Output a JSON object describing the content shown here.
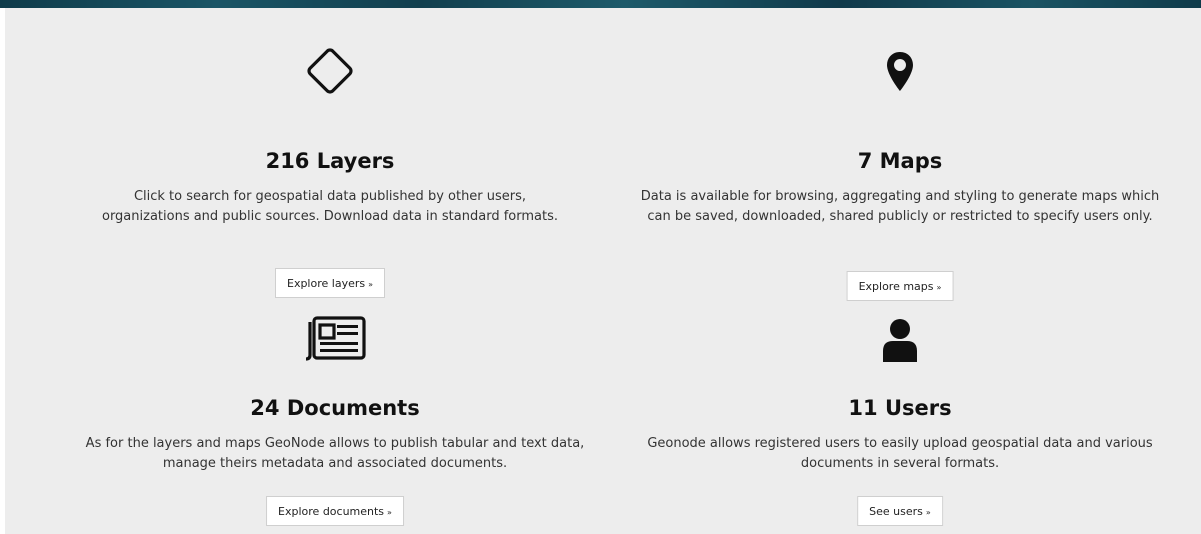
{
  "stats": {
    "layers": {
      "icon": "diamond-outline-icon",
      "title": "216 Layers",
      "description": "Click to search for geospatial data published by other users, organizations and public sources. Download data in standard formats.",
      "button_label": "Explore layers",
      "button_arrow": "»"
    },
    "maps": {
      "icon": "map-marker-icon",
      "title": "7 Maps",
      "description": "Data is available for browsing, aggregating and styling to generate maps which can be saved, downloaded, shared publicly or restricted to specify users only.",
      "button_label": "Explore maps",
      "button_arrow": "»"
    },
    "documents": {
      "icon": "newspaper-icon",
      "title": "24 Documents",
      "description": "As for the layers and maps GeoNode allows to publish tabular and text data, manage theirs metadata and associated documents.",
      "button_label": "Explore documents",
      "button_arrow": "»"
    },
    "users": {
      "icon": "user-icon",
      "title": "11 Users",
      "description": "Geonode allows registered users to easily upload geospatial data and various documents in several formats.",
      "button_label": "See users",
      "button_arrow": "»"
    }
  },
  "colors": {
    "panel_background": "#ededed",
    "banner": "#1a5566",
    "text": "#1a1a1a",
    "button_border": "#cfcfcf"
  }
}
